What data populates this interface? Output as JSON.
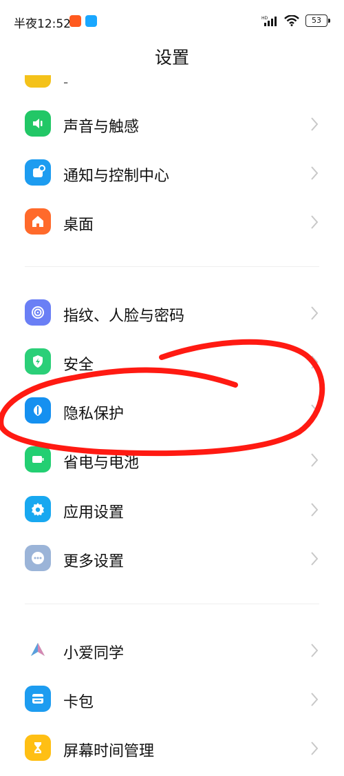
{
  "status_bar": {
    "time": "半夜12:52",
    "network_label": "HD",
    "battery_level": "53"
  },
  "header": {
    "title": "设置"
  },
  "partial_item": {
    "label": "-"
  },
  "sections": [
    {
      "items": [
        {
          "label": "声音与触感",
          "icon": "sound-icon",
          "color": "#22c766"
        },
        {
          "label": "通知与控制中心",
          "icon": "notification-icon",
          "color": "#1d9cf0"
        },
        {
          "label": "桌面",
          "icon": "home-icon",
          "color": "#ff6a2b"
        }
      ]
    },
    {
      "items": [
        {
          "label": "指纹、人脸与密码",
          "icon": "fingerprint-icon",
          "color": "#6a7ff5"
        },
        {
          "label": "安全",
          "icon": "shield-icon",
          "color": "#2bcf78"
        },
        {
          "label": "隐私保护",
          "icon": "privacy-icon",
          "color": "#1590f0"
        },
        {
          "label": "省电与电池",
          "icon": "battery-icon",
          "color": "#23cf72"
        },
        {
          "label": "应用设置",
          "icon": "gear-icon",
          "color": "#18a8f0"
        },
        {
          "label": "更多设置",
          "icon": "more-icon",
          "color": "#9bb4d8"
        }
      ]
    },
    {
      "items": [
        {
          "label": "小爱同学",
          "icon": "xiaoai-icon",
          "color": "#ffffff"
        },
        {
          "label": "卡包",
          "icon": "card-icon",
          "color": "#1d9cf0"
        },
        {
          "label": "屏幕时间管理",
          "icon": "hourglass-icon",
          "color": "#ffbf14"
        }
      ]
    }
  ],
  "annotation": {
    "stroke_color": "#ff1a12"
  }
}
